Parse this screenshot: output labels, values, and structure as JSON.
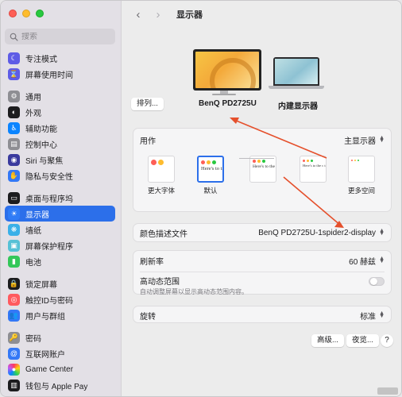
{
  "sidebar": {
    "search_placeholder": "搜索",
    "groups": [
      [
        {
          "label": "专注模式",
          "icon": "moon-icon",
          "color": "#5e5ce6"
        },
        {
          "label": "屏幕使用时间",
          "icon": "hourglass-icon",
          "color": "#5e5ce6"
        }
      ],
      [
        {
          "label": "通用",
          "icon": "gear-icon",
          "color": "#8e8e93"
        },
        {
          "label": "外观",
          "icon": "appearance-icon",
          "color": "#1c1c1e"
        },
        {
          "label": "辅助功能",
          "icon": "accessibility-icon",
          "color": "#0a84ff"
        },
        {
          "label": "控制中心",
          "icon": "control-center-icon",
          "color": "#8e8e93"
        },
        {
          "label": "Siri 与聚焦",
          "icon": "siri-icon",
          "color": "#3a3a9e"
        },
        {
          "label": "隐私与安全性",
          "icon": "hand-icon",
          "color": "#3478f6"
        }
      ],
      [
        {
          "label": "桌面与程序坞",
          "icon": "dock-icon",
          "color": "#1c1c1e"
        },
        {
          "label": "显示器",
          "icon": "sun-icon",
          "color": "#2f7cf6",
          "active": true
        },
        {
          "label": "墙纸",
          "icon": "wallpaper-icon",
          "color": "#3ab0e8"
        },
        {
          "label": "屏幕保护程序",
          "icon": "screensaver-icon",
          "color": "#56c1d6"
        },
        {
          "label": "电池",
          "icon": "battery-icon",
          "color": "#34c759"
        }
      ],
      [
        {
          "label": "锁定屏幕",
          "icon": "lock-icon",
          "color": "#1c1c1e"
        },
        {
          "label": "触控ID与密码",
          "icon": "fingerprint-icon",
          "color": "#ff5a5f"
        },
        {
          "label": "用户与群组",
          "icon": "users-icon",
          "color": "#3478f6"
        }
      ],
      [
        {
          "label": "密码",
          "icon": "key-icon",
          "color": "#8e8e93"
        },
        {
          "label": "互联网账户",
          "icon": "at-icon",
          "color": "#3478f6"
        },
        {
          "label": "Game Center",
          "icon": "game-center-icon",
          "color": "#ffffff"
        },
        {
          "label": "钱包与 Apple Pay",
          "icon": "wallet-icon",
          "color": "#1c1c1e"
        }
      ]
    ]
  },
  "toolbar": {
    "title": "显示器",
    "back": "‹",
    "forward": "›"
  },
  "displays": {
    "arrange_label": "排列...",
    "external_name": "BenQ PD2725U",
    "internal_name": "内建显示器"
  },
  "resolution": {
    "label": "用作",
    "value": "主显示器",
    "options": [
      {
        "label": "更大字体",
        "text": ""
      },
      {
        "label": "默认",
        "text": "Here's to troublemake"
      },
      {
        "label": "",
        "text": "Here's to the troublemakers ones"
      },
      {
        "label": "",
        "text": "Here's to the c troublemakers ones who see t"
      },
      {
        "label": "更多空间",
        "text": ""
      }
    ],
    "selected_index": 1
  },
  "color_profile": {
    "label": "颜色描述文件",
    "value": "BenQ PD2725U-1spider2-display"
  },
  "refresh": {
    "label": "刷新率",
    "value": "60 赫兹"
  },
  "hdr": {
    "label": "高动态范围",
    "sub": "自动调整屏幕以显示高动态范围内容。",
    "enabled": false
  },
  "rotation": {
    "label": "旋转",
    "value": "标准"
  },
  "footer": {
    "advanced": "高级...",
    "night_shift": "夜览...",
    "help": "?"
  },
  "colors": {
    "accent": "#2c6fea",
    "annotation": "#e5502c"
  }
}
